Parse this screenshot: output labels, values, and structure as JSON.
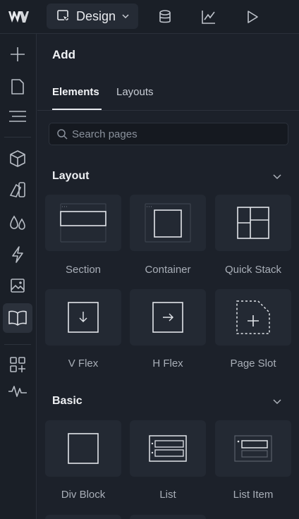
{
  "topbar": {
    "mode_label": "Design",
    "icons": [
      "webflow-logo",
      "cursor-icon",
      "chevron-down-icon",
      "database-icon",
      "analytics-icon",
      "play-icon"
    ]
  },
  "rail": {
    "items": [
      "add-icon",
      "page-icon",
      "navigator-icon",
      "components-icon",
      "style-icon",
      "color-variables-icon",
      "interactions-icon",
      "assets-icon",
      "library-icon",
      "apps-icon",
      "activity-icon"
    ],
    "active": "library-icon"
  },
  "panel": {
    "title": "Add",
    "tabs": {
      "elements": "Elements",
      "layouts": "Layouts"
    },
    "search": {
      "placeholder": "Search pages",
      "value": ""
    },
    "sections": {
      "layout": {
        "title": "Layout",
        "items": [
          {
            "label": "Section"
          },
          {
            "label": "Container"
          },
          {
            "label": "Quick Stack"
          },
          {
            "label": "V Flex"
          },
          {
            "label": "H Flex"
          },
          {
            "label": "Page Slot"
          }
        ]
      },
      "basic": {
        "title": "Basic",
        "items": [
          {
            "label": "Div Block"
          },
          {
            "label": "List"
          },
          {
            "label": "List Item"
          }
        ]
      }
    }
  },
  "colors": {
    "background": "#1b2029",
    "card": "#232933",
    "text": "#e6e8eb",
    "muted": "#a9afb8"
  }
}
